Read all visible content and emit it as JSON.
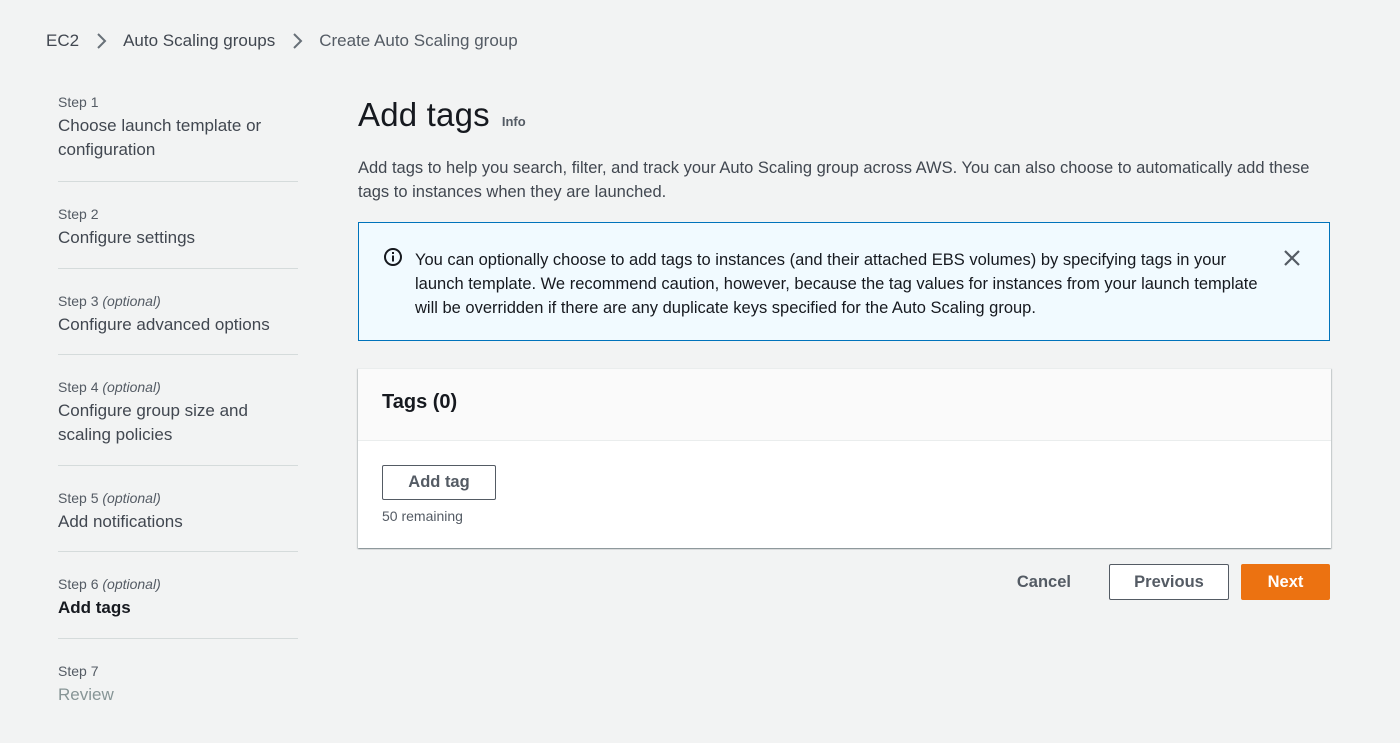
{
  "breadcrumb": {
    "items": [
      "EC2",
      "Auto Scaling groups"
    ],
    "current": "Create Auto Scaling group"
  },
  "steps": [
    {
      "num": "Step 1",
      "optional": "",
      "title": "Choose launch template or configuration",
      "state": "done"
    },
    {
      "num": "Step 2",
      "optional": "",
      "title": "Configure settings",
      "state": "done"
    },
    {
      "num": "Step 3",
      "optional": "(optional)",
      "title": "Configure advanced options",
      "state": "done"
    },
    {
      "num": "Step 4",
      "optional": "(optional)",
      "title": "Configure group size and scaling policies",
      "state": "done"
    },
    {
      "num": "Step 5",
      "optional": "(optional)",
      "title": "Add notifications",
      "state": "done"
    },
    {
      "num": "Step 6",
      "optional": "(optional)",
      "title": "Add tags",
      "state": "active"
    },
    {
      "num": "Step 7",
      "optional": "",
      "title": "Review",
      "state": "disabled"
    }
  ],
  "header": {
    "title": "Add tags",
    "info": "Info",
    "description": "Add tags to help you search, filter, and track your Auto Scaling group across AWS. You can also choose to automatically add these tags to instances when they are launched."
  },
  "alert": {
    "icon": "info-icon",
    "text": "You can optionally choose to add tags to instances (and their attached EBS volumes) by specifying tags in your launch template. We recommend caution, however, because the tag values for instances from your launch template will be overridden if there are any duplicate keys specified for the Auto Scaling group."
  },
  "tags_panel": {
    "title": "Tags (0)",
    "add_button": "Add tag",
    "remaining": "50 remaining"
  },
  "actions": {
    "cancel": "Cancel",
    "previous": "Previous",
    "next": "Next"
  },
  "colors": {
    "accent": "#ec7211",
    "info_border": "#0073bb",
    "info_bg": "#f1faff"
  }
}
